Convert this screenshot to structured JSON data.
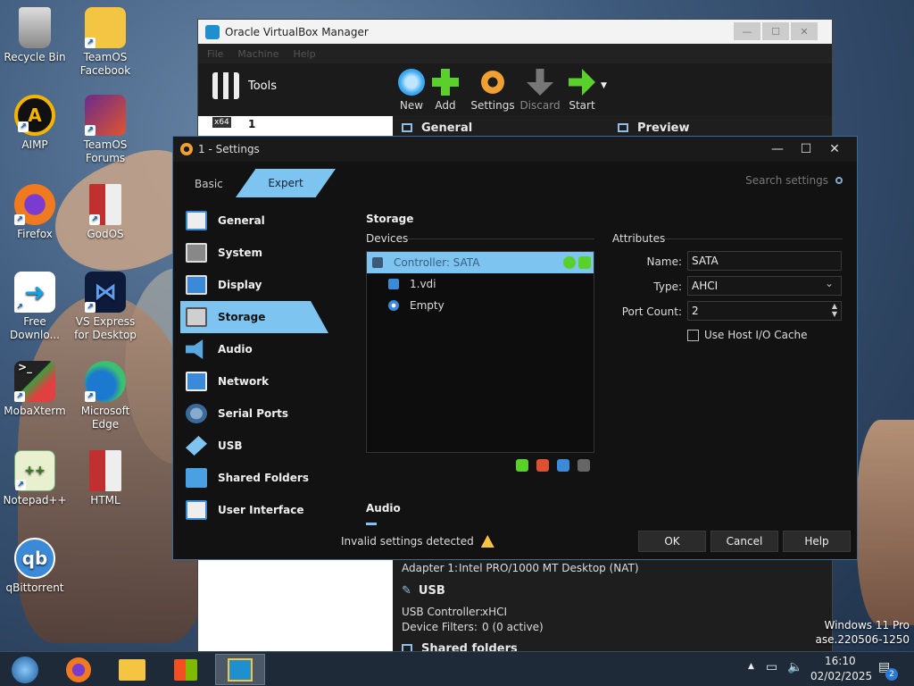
{
  "desktop": {
    "icons": [
      {
        "label": "Recycle Bin",
        "icon": "recycle-bin-icon"
      },
      {
        "label": "TeamOS Facebook",
        "icon": "folder-shortcut-icon"
      },
      {
        "label": "AIMP",
        "icon": "aimp-icon"
      },
      {
        "label": "TeamOS Forums",
        "icon": "firefox-document-icon"
      },
      {
        "label": "Firefox",
        "icon": "firefox-icon"
      },
      {
        "label": "GodOS",
        "icon": "document-icon"
      },
      {
        "label": "Free Downlo...",
        "icon": "free-download-icon"
      },
      {
        "label": "VS Express for Desktop",
        "icon": "visual-studio-icon"
      },
      {
        "label": "MobaXterm",
        "icon": "mobaxterm-icon"
      },
      {
        "label": "Microsoft Edge",
        "icon": "edge-icon"
      },
      {
        "label": "Notepad++",
        "icon": "notepadpp-icon"
      },
      {
        "label": "HTML",
        "icon": "html-file-icon"
      },
      {
        "label": "qBittorrent",
        "icon": "qbittorrent-icon"
      }
    ]
  },
  "vbox_main": {
    "title": "Oracle VirtualBox Manager",
    "menu": [
      "File",
      "Machine",
      "Help"
    ],
    "tools_label": "Tools",
    "toolbar": {
      "new": "New",
      "add": "Add",
      "settings": "Settings",
      "discard": "Discard",
      "start": "Start"
    },
    "vm_badge": "x64",
    "vm_name": "1",
    "general_label": "General",
    "preview_label": "Preview",
    "adapter_label": "Adapter 1:",
    "adapter_value": "Intel PRO/1000 MT Desktop (NAT)",
    "usb_label": "USB",
    "usb_controller_label": "USB Controller:",
    "usb_controller_value": "xHCI",
    "device_filters_label": "Device Filters:",
    "device_filters_value": "0 (0 active)",
    "shared_folders_label": "Shared folders"
  },
  "settings": {
    "title": "1 - Settings",
    "mode_basic": "Basic",
    "mode_expert": "Expert",
    "search_placeholder": "Search settings",
    "nav": [
      {
        "label": "General",
        "icon": "monitor-icon"
      },
      {
        "label": "System",
        "icon": "chip-icon"
      },
      {
        "label": "Display",
        "icon": "display-icon"
      },
      {
        "label": "Storage",
        "icon": "storage-icon"
      },
      {
        "label": "Audio",
        "icon": "speaker-icon"
      },
      {
        "label": "Network",
        "icon": "network-icon"
      },
      {
        "label": "Serial Ports",
        "icon": "serial-port-icon"
      },
      {
        "label": "USB",
        "icon": "usb-icon"
      },
      {
        "label": "Shared Folders",
        "icon": "folder-icon"
      },
      {
        "label": "User Interface",
        "icon": "user-interface-icon"
      }
    ],
    "section_title": "Storage",
    "devices_label": "Devices",
    "attributes_label": "Attributes",
    "tree": {
      "controller": "Controller: SATA",
      "disk": "1.vdi",
      "optical": "Empty"
    },
    "attrs": {
      "name_label": "Name:",
      "name_value": "SATA",
      "type_label": "Type:",
      "type_value": "AHCI",
      "port_count_label": "Port Count:",
      "port_count_value": "2",
      "host_cache_label": "Use Host I/O Cache"
    },
    "audio_section": "Audio",
    "invalid_text": "Invalid settings detected",
    "buttons": {
      "ok": "OK",
      "cancel": "Cancel",
      "help": "Help"
    }
  },
  "watermark": {
    "line1": "Windows 11 Pro",
    "line2": "ase.220506-1250"
  },
  "taskbar": {
    "time": "16:10",
    "date": "02/02/2025",
    "notification_count": "2"
  },
  "colors": {
    "accent": "#7ec4f0",
    "dialog_bg": "#121212",
    "taskbar_bg": "#1f2a38"
  }
}
